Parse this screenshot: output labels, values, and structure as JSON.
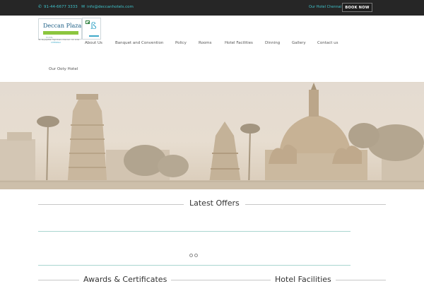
{
  "topbar": {
    "phone": "91-44-6677 3333",
    "email": "info@deccanhotels.com",
    "hotel_link": "Our Hotel Chennai",
    "book_now": "BOOK NOW",
    "phone_icon": "phone-icon",
    "mail_icon": "mail-icon"
  },
  "logo": {
    "name": "Deccan Plaza",
    "sub": "HOTEL",
    "address": "36, Royapettah High Road, Chennai - 14. India",
    "city": "CHENNAI"
  },
  "nav": {
    "items": [
      "About Us",
      "Banquet and Convention",
      "Policy",
      "Rooms",
      "Hotel Facilities",
      "Dinning",
      "Gallery",
      "Contact us",
      "Our Ooty Hotel"
    ]
  },
  "sections": {
    "latest_offers": "Latest Offers",
    "awards": "Awards & Certificates",
    "facilities": "Hotel Facilities"
  },
  "slider": {
    "dot_count": 2
  },
  "colors": {
    "accent": "#3fc1c9",
    "topbar_bg": "#262626",
    "hero_tone": "#e5dcd0"
  }
}
